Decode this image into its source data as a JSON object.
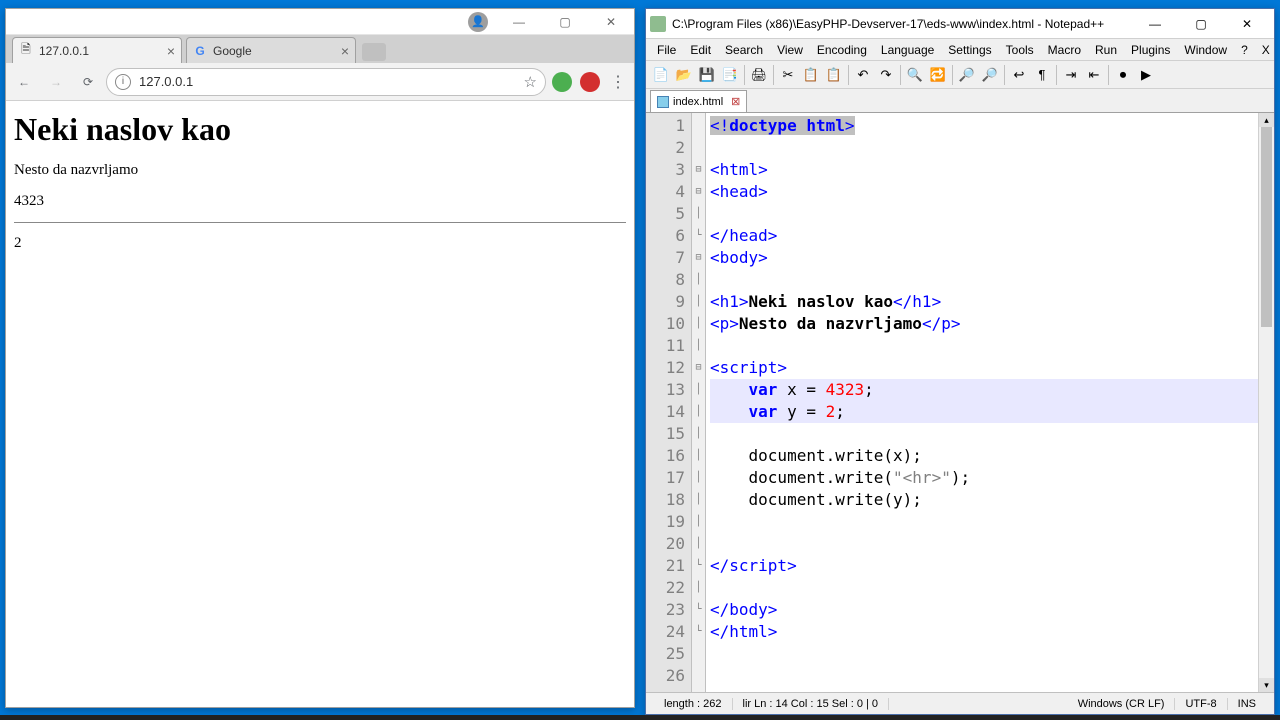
{
  "chrome": {
    "tabs": [
      {
        "label": "127.0.0.1",
        "active": true
      },
      {
        "label": "Google",
        "active": false
      }
    ],
    "address": "127.0.0.1",
    "page": {
      "h1": "Neki naslov kao",
      "p": "Nesto da nazvrljamo",
      "x": "4323",
      "y": "2"
    }
  },
  "npp": {
    "title": "C:\\Program Files (x86)\\EasyPHP-Devserver-17\\eds-www\\index.html - Notepad++",
    "menu": [
      "File",
      "Edit",
      "Search",
      "View",
      "Encoding",
      "Language",
      "Settings",
      "Tools",
      "Macro",
      "Run",
      "Plugins",
      "Window",
      "?",
      "X"
    ],
    "tab": "index.html",
    "lines": [
      {
        "n": "1",
        "fold": "",
        "html": "<span class='sel'><span class='tag'>&lt;!</span><span class='kw'>doctype html</span><span class='tag'>&gt;</span></span>"
      },
      {
        "n": "2",
        "fold": "",
        "html": ""
      },
      {
        "n": "3",
        "fold": "⊟",
        "html": "<span class='tag'>&lt;html&gt;</span>"
      },
      {
        "n": "4",
        "fold": "⊟",
        "html": "<span class='tag'>&lt;head&gt;</span>"
      },
      {
        "n": "5",
        "fold": "│",
        "html": ""
      },
      {
        "n": "6",
        "fold": "└",
        "html": "<span class='tag'>&lt;/head&gt;</span>"
      },
      {
        "n": "7",
        "fold": "⊟",
        "html": "<span class='tag'>&lt;body&gt;</span>"
      },
      {
        "n": "8",
        "fold": "│",
        "html": ""
      },
      {
        "n": "9",
        "fold": "│",
        "html": "<span class='tag'>&lt;h1&gt;</span><span class='black'>Neki naslov kao</span><span class='tag'>&lt;/h1&gt;</span>"
      },
      {
        "n": "10",
        "fold": "│",
        "html": "<span class='tag'>&lt;p&gt;</span><span class='black'>Nesto da nazvrljamo</span><span class='tag'>&lt;/p&gt;</span>"
      },
      {
        "n": "11",
        "fold": "│",
        "html": ""
      },
      {
        "n": "12",
        "fold": "⊟",
        "html": "<span class='tag'>&lt;script&gt;</span>"
      },
      {
        "n": "13",
        "fold": "│",
        "hl": true,
        "html": "    <span class='kw var'>var</span> x = <span class='num'>4323</span>;"
      },
      {
        "n": "14",
        "fold": "│",
        "hl": true,
        "html": "    <span class='kw var'>var</span> y = <span class='num'>2</span>;"
      },
      {
        "n": "15",
        "fold": "│",
        "html": ""
      },
      {
        "n": "16",
        "fold": "│",
        "html": "    document.write(x);"
      },
      {
        "n": "17",
        "fold": "│",
        "html": "    document.write(<span class='str'>\"&lt;hr&gt;\"</span>);"
      },
      {
        "n": "18",
        "fold": "│",
        "html": "    document.write(y);"
      },
      {
        "n": "19",
        "fold": "│",
        "html": ""
      },
      {
        "n": "20",
        "fold": "│",
        "html": ""
      },
      {
        "n": "21",
        "fold": "└",
        "html": "<span class='tag'>&lt;/script&gt;</span>"
      },
      {
        "n": "22",
        "fold": "│",
        "html": ""
      },
      {
        "n": "23",
        "fold": "└",
        "html": "<span class='tag'>&lt;/body&gt;</span>"
      },
      {
        "n": "24",
        "fold": "└",
        "html": "<span class='tag'>&lt;/html&gt;</span>"
      },
      {
        "n": "25",
        "fold": "",
        "html": ""
      },
      {
        "n": "26",
        "fold": "",
        "html": ""
      }
    ],
    "status": {
      "length": "length : 262",
      "pos": "lir  Ln : 14    Col : 15    Sel : 0 | 0",
      "eol": "Windows (CR LF)",
      "enc": "UTF-8",
      "ins": "INS"
    }
  }
}
